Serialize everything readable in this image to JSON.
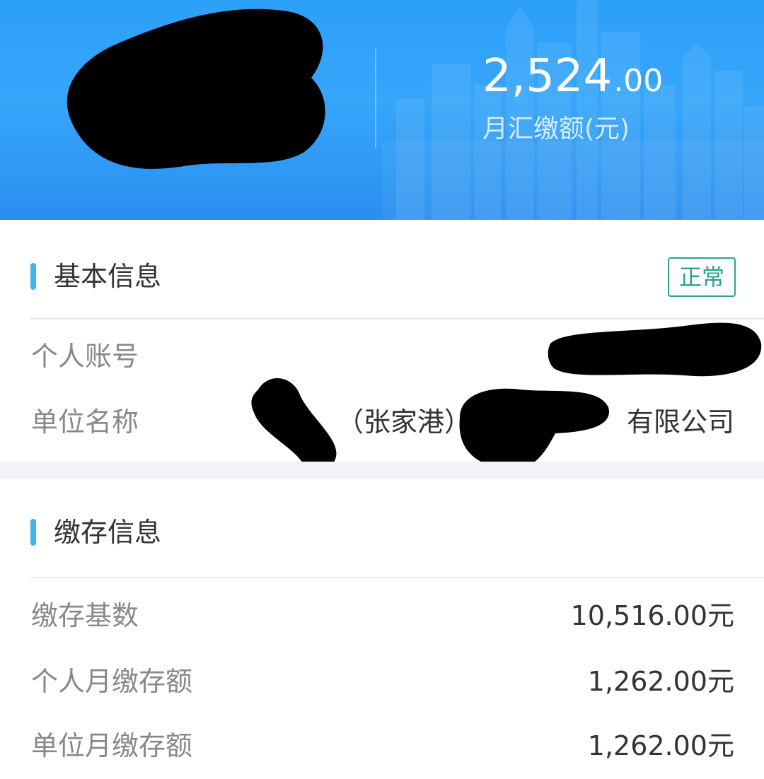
{
  "header": {
    "amount_int": "2,524",
    "amount_dec": ".00",
    "amount_label": "月汇缴额(元)"
  },
  "basic_info": {
    "title": "基本信息",
    "status": "正常",
    "rows": [
      {
        "label": "个人账号",
        "value": ""
      },
      {
        "label": "单位名称",
        "value": "（张家港）有限公司"
      }
    ],
    "company_middle": "（张家港）",
    "company_suffix": "有限公司"
  },
  "deposit_info": {
    "title": "缴存信息",
    "rows": [
      {
        "label": "缴存基数",
        "value": "10,516.00元"
      },
      {
        "label": "个人月缴存额",
        "value": "1,262.00元"
      },
      {
        "label": "单位月缴存额",
        "value": "1,262.00元"
      }
    ]
  },
  "colors": {
    "header_blue": "#2c9ff8",
    "accent_bar": "#3fb5ef",
    "status_green": "#2aa290",
    "label_gray": "#888888",
    "value_dark": "#333333"
  }
}
